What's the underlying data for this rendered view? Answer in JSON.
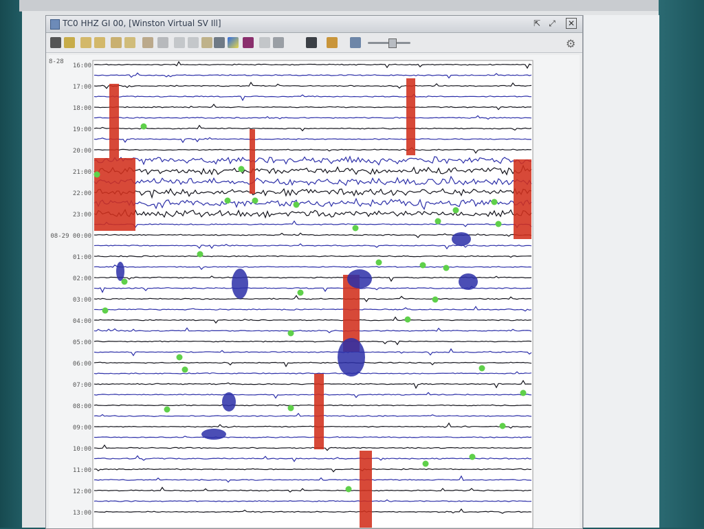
{
  "window": {
    "title": "TC0 HHZ GI 00, [Winston Virtual SV Ill]",
    "buttons": {
      "undock": "⇱",
      "maximize": "⤢",
      "close": "✕"
    }
  },
  "toolbar": {
    "icons": [
      "save-icon",
      "copy-icon",
      "zoom-in-icon",
      "zoom-out-icon",
      "refresh-icon",
      "clipping-icon",
      "spectrogram-icon",
      "color-icon",
      "filter-icon",
      "export-icon",
      "person-icon",
      "pick-icon",
      "sync-icon"
    ],
    "gain_slider_value": 0.5
  },
  "plot": {
    "top_left_label": "8-28",
    "time_labels": [
      "16:00",
      "17:00",
      "18:00",
      "19:00",
      "20:00",
      "21:00",
      "22:00",
      "23:00",
      "08-29 00:00",
      "01:00",
      "02:00",
      "03:00",
      "04:00",
      "05:00",
      "06:00",
      "07:00",
      "08:00",
      "09:00",
      "10:00",
      "11:00",
      "12:00",
      "13:00"
    ],
    "colors": {
      "trace_a": "#14141c",
      "trace_b": "#2c2fa8",
      "clip": "#d2301c",
      "pick": "#5fd04a",
      "background": "#ffffff"
    }
  }
}
